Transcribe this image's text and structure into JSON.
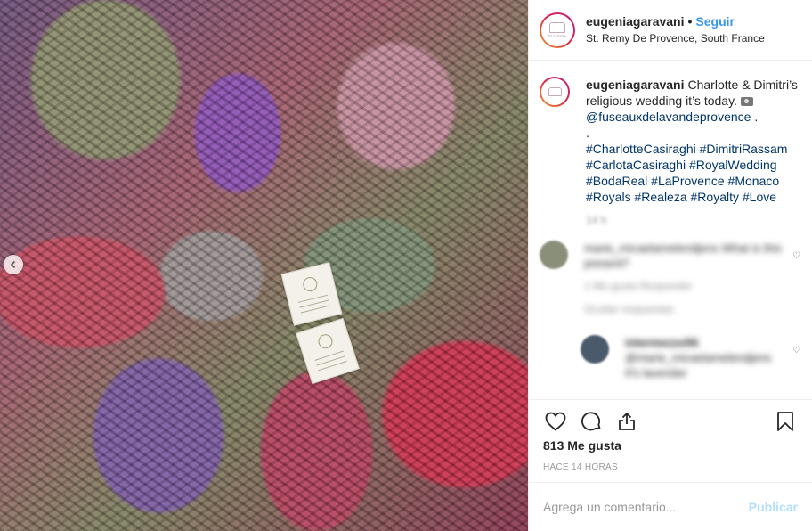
{
  "post": {
    "username": "eugeniagaravani",
    "separator": "•",
    "follow_label": "Seguir",
    "location": "St. Remy De Provence, South France",
    "avatar_text": "EUGENIA"
  },
  "caption": {
    "username": "eugeniagaravani",
    "text": "Charlotte & Dimitri’s religious wedding it’s today.",
    "mention": "@fuseauxdelavandeprovence",
    "mention_suffix": " .",
    "dot_line": ".",
    "hashtags_line1": "#CharlotteCasiraghi #DimitriRassam",
    "hashtags_line2": "#CarlotaCasiraghi #RoyalWedding",
    "hashtags_line3": "#BodaReal #LaProvence #Monaco",
    "hashtags_line4": "#Royals #Realeza #Royalty #Love",
    "time": "14 h"
  },
  "comments": [
    {
      "text": "marie_micaelamelendjens What is this present?",
      "meta": "1 Me gusta   Responder",
      "replies": "Ocultar respuestas",
      "avatar_color": "#8a8f7a"
    },
    {
      "username": "intermezzo56",
      "text": "@marie_micaelamelendjens",
      "text2": "It's lavender",
      "avatar_color": "#4a5a6a"
    }
  ],
  "actions": {
    "like_icon": "heart-icon",
    "comment_icon": "comment-icon",
    "share_icon": "share-icon",
    "save_icon": "bookmark-icon"
  },
  "likes": "813 Me gusta",
  "posted": "HACE 14 HORAS",
  "add_comment": {
    "placeholder": "Agrega un comentario...",
    "publish_label": "Publicar"
  },
  "colors": {
    "follow": "#3897f0",
    "hashtag": "#003569",
    "publish_disabled": "#b2dffc"
  }
}
